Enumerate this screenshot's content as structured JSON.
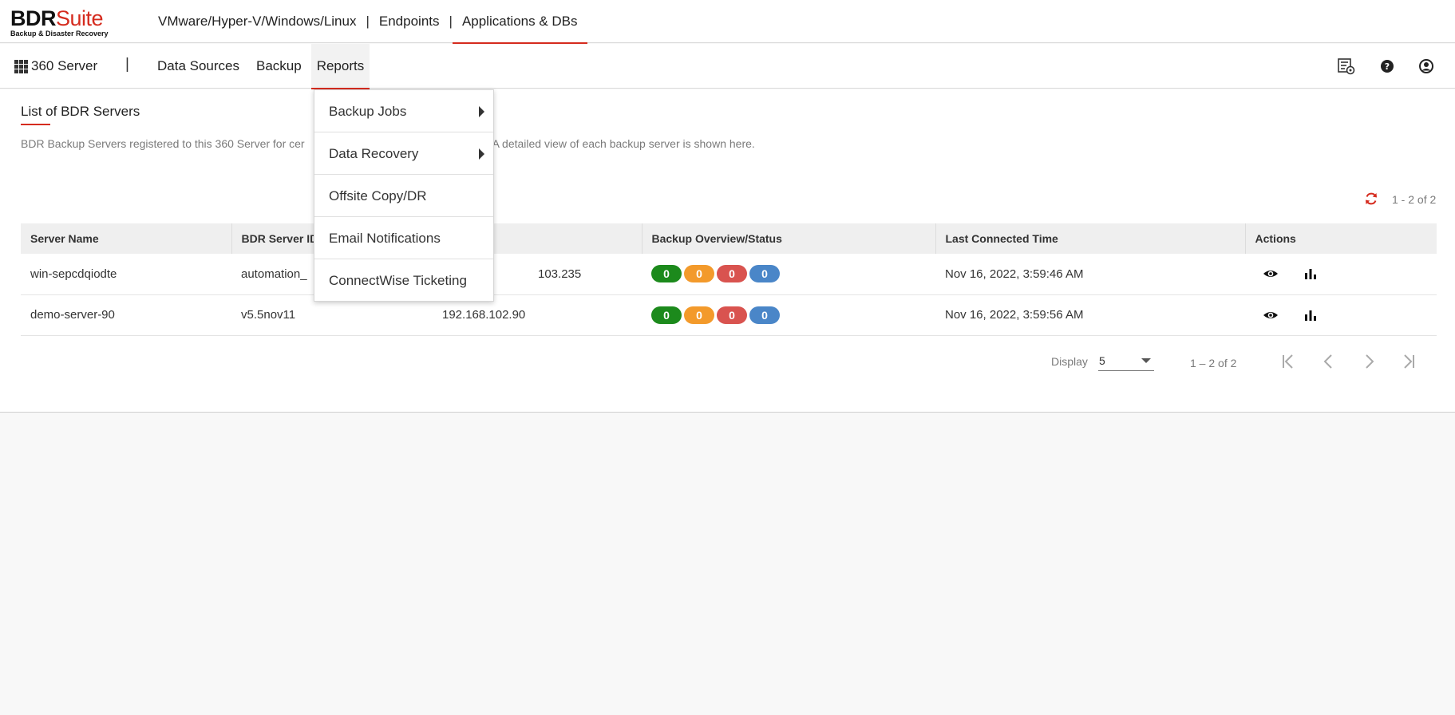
{
  "brand": {
    "part1": "BDR",
    "part2": "Suite",
    "tagline": "Backup & Disaster Recovery",
    "accent": "#d52b1e"
  },
  "product_nav": {
    "items": [
      "VMware/Hyper-V/Windows/Linux",
      "Endpoints",
      "Applications & DBs"
    ],
    "separator": "|",
    "active_index": 2
  },
  "app_switch": {
    "label": "360 Server",
    "icon": "grid-icon"
  },
  "main_nav": {
    "separator": "|",
    "items": [
      "Data Sources",
      "Backup",
      "Reports"
    ],
    "active": "Reports"
  },
  "header_icons": [
    "settings-list-icon",
    "help-icon",
    "account-icon"
  ],
  "page": {
    "title": "List of BDR Servers",
    "description_visible_left": "BDR Backup Servers registered to this 360 Server for cer",
    "description_visible_right": ". A detailed view of each backup server is shown here.",
    "range": "1 - 2 of 2"
  },
  "table": {
    "columns": [
      "Server Name",
      "BDR Server ID",
      "",
      "Backup Overview/Status",
      "Last Connected Time",
      "Actions"
    ],
    "rows": [
      {
        "server_name": "win-sepcdqiodte",
        "server_id": "automation_",
        "ip": "103.235",
        "status": [
          "0",
          "0",
          "0",
          "0"
        ],
        "last_connected": "Nov 16, 2022, 3:59:46 AM"
      },
      {
        "server_name": "demo-server-90",
        "server_id": "v5.5nov11",
        "ip": "192.168.102.90",
        "status": [
          "0",
          "0",
          "0",
          "0"
        ],
        "last_connected": "Nov 16, 2022, 3:59:56 AM"
      }
    ],
    "status_colors": [
      "#1c8a1c",
      "#f39a2b",
      "#d9534f",
      "#4a86c8"
    ]
  },
  "pagination": {
    "display_label": "Display",
    "page_size": "5",
    "range": "1 – 2 of 2"
  },
  "reports_menu": {
    "items": [
      {
        "label": "Backup Jobs",
        "submenu": true
      },
      {
        "label": "Data Recovery",
        "submenu": true
      },
      {
        "label": "Offsite Copy/DR",
        "submenu": false
      },
      {
        "label": "Email Notifications",
        "submenu": false
      },
      {
        "label": "ConnectWise Ticketing",
        "submenu": false
      }
    ]
  }
}
